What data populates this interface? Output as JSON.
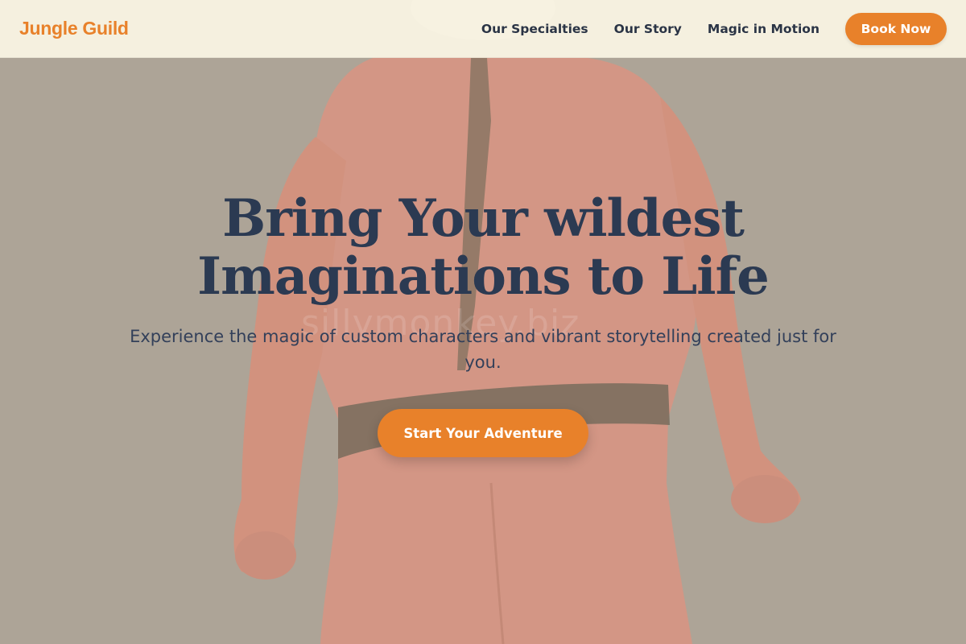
{
  "header": {
    "logo": "Jungle Guild",
    "nav": [
      {
        "label": "Our Specialties"
      },
      {
        "label": "Our Story"
      },
      {
        "label": "Magic in Motion"
      }
    ],
    "book_label": "Book Now"
  },
  "hero": {
    "title": "Bring Your wildest Imaginations to Life",
    "subtitle": "Experience the magic of custom characters and vibrant storytelling created just for you.",
    "cta_label": "Start Your Adventure",
    "watermark": "sillymonkey.biz"
  },
  "colors": {
    "accent": "#e8812a",
    "header_bg": "#f8f3e2",
    "heading": "#2b3a52",
    "background": "#a79f94",
    "suit": "#e58c78"
  }
}
